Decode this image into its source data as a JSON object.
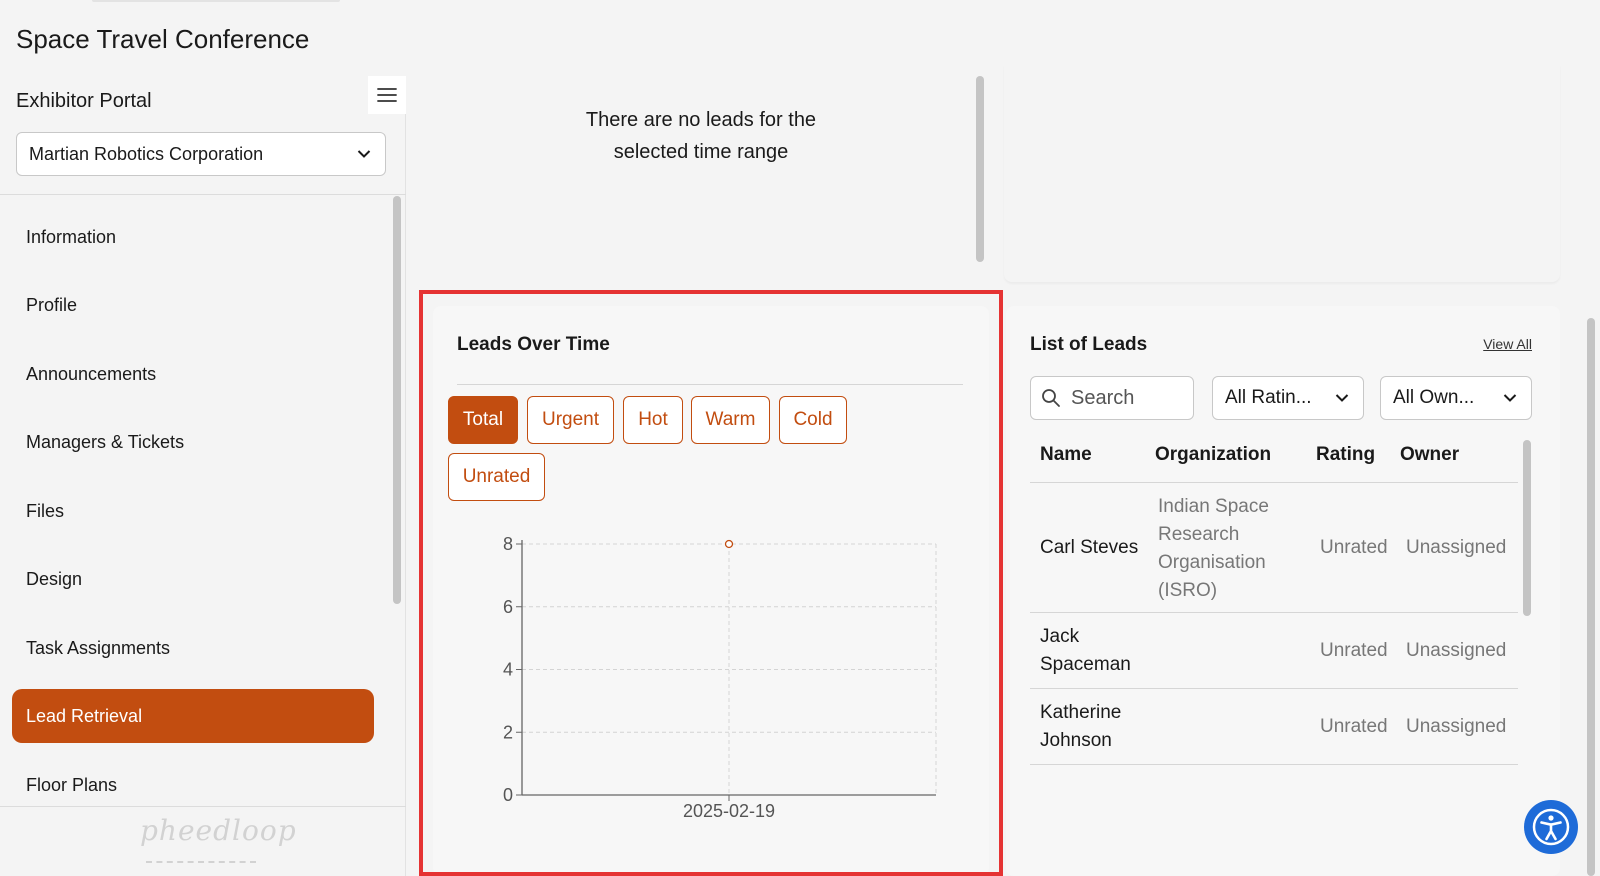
{
  "app": {
    "title": "Space Travel Conference"
  },
  "sidebar": {
    "portal_title": "Exhibitor Portal",
    "organization": "Martian Robotics Corporation",
    "items": [
      {
        "label": "Information",
        "active": false
      },
      {
        "label": "Profile",
        "active": false
      },
      {
        "label": "Announcements",
        "active": false
      },
      {
        "label": "Managers & Tickets",
        "active": false
      },
      {
        "label": "Files",
        "active": false
      },
      {
        "label": "Design",
        "active": false
      },
      {
        "label": "Task Assignments",
        "active": false
      },
      {
        "label": "Lead Retrieval",
        "active": true
      },
      {
        "label": "Floor Plans",
        "active": false
      }
    ],
    "brand": "pheedloop"
  },
  "top_left_card": {
    "empty_line1": "There are no leads for the",
    "empty_line2": "selected time range"
  },
  "leads_over_time": {
    "title": "Leads Over Time",
    "filters": [
      {
        "label": "Total",
        "active": true
      },
      {
        "label": "Urgent",
        "active": false
      },
      {
        "label": "Hot",
        "active": false
      },
      {
        "label": "Warm",
        "active": false
      },
      {
        "label": "Cold",
        "active": false
      },
      {
        "label": "Unrated",
        "active": false
      }
    ]
  },
  "chart_data": {
    "type": "line",
    "title": "Leads Over Time",
    "x": [
      "2025-02-19"
    ],
    "series": [
      {
        "values": [
          8
        ]
      }
    ],
    "ylim": [
      0,
      8
    ],
    "yticks": [
      0,
      2,
      4,
      6,
      8
    ],
    "grid": true,
    "xlabel": "",
    "ylabel": "",
    "color": "#c24d10"
  },
  "list_of_leads": {
    "title": "List of Leads",
    "view_all": "View All",
    "search_placeholder": "Search",
    "rating_filter": "All Ratin...",
    "owner_filter": "All Own...",
    "columns": [
      "Name",
      "Organization",
      "Rating",
      "Owner"
    ],
    "rows": [
      {
        "name": "Carl Steves",
        "organization": "Indian Space Research Organisation (ISRO)",
        "rating": "Unrated",
        "owner": "Unassigned"
      },
      {
        "name": "Jack Spaceman",
        "organization": "",
        "rating": "Unrated",
        "owner": "Unassigned"
      },
      {
        "name": "Katherine Johnson",
        "organization": "",
        "rating": "Unrated",
        "owner": "Unassigned"
      }
    ]
  },
  "colors": {
    "accent": "#c24d10",
    "highlight": "#e53333",
    "a11y": "#1e6bd8"
  }
}
